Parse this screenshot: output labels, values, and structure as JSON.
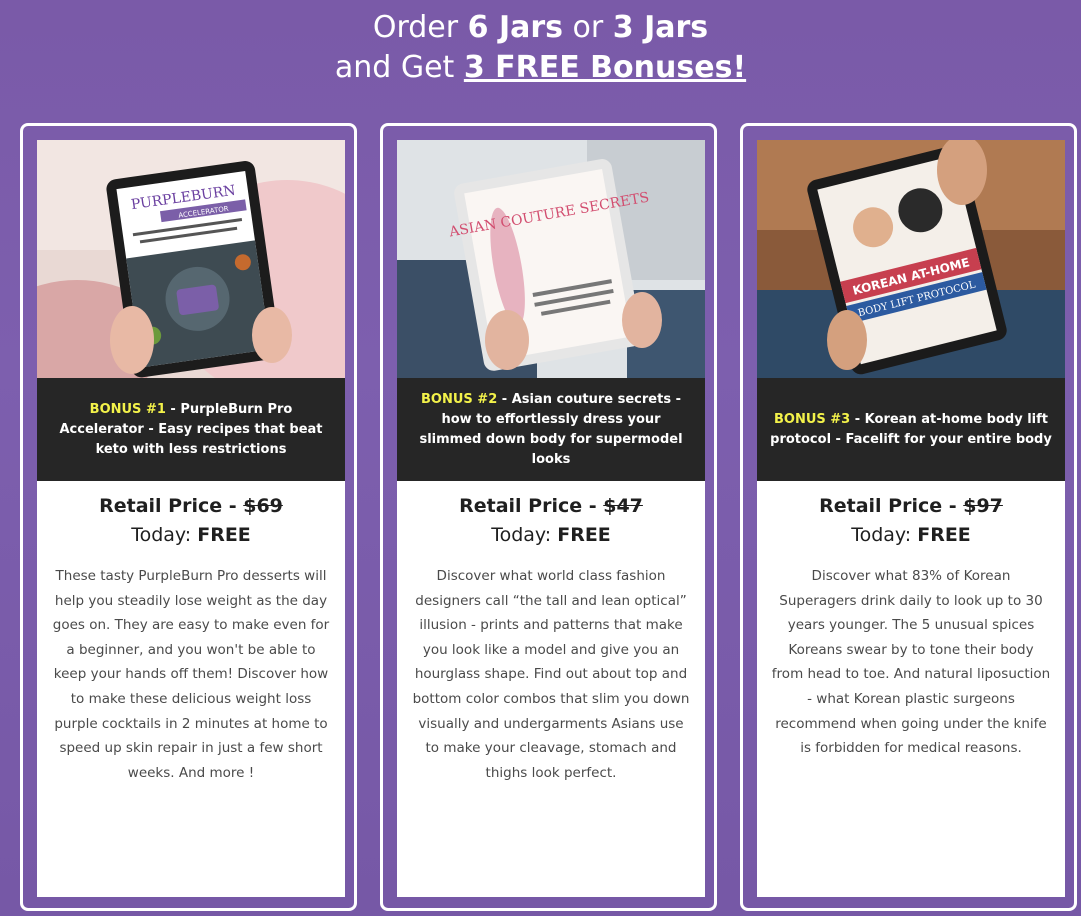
{
  "headline": {
    "line1_pre": "Order ",
    "line1_bold1": "6 Jars",
    "line1_mid": " or ",
    "line1_bold2": "3 Jars",
    "line2_pre": "and Get ",
    "line2_link": "3 FREE Bonuses!"
  },
  "bonuses": [
    {
      "image_label": "PURPLEBURN",
      "image_sub": "ACCELERATOR",
      "image_caption": "EASY RECIPES THAT BEAT KETO WITH LESS RESTRICTIONS",
      "tag": "BONUS #1",
      "text": " - PurpleBurn Pro Accelerator - Easy recipes that beat keto with less restrictions",
      "price_label": "Retail Price - ",
      "price": "$69",
      "today_label": "Today: ",
      "today_value": "FREE",
      "description": "These tasty PurpleBurn Pro desserts will help you steadily lose weight as the day goes on. They are easy to make even for a beginner, and you won't be able to keep your hands off them! Discover how to make these delicious weight loss purple cocktails in 2 minutes at home to speed up skin repair in just a few short weeks. And more !"
    },
    {
      "image_label": "ASIAN COUTURE SECRETS",
      "image_caption": "HOW TO EFFORTLESSLY DRESS YOUR SLIMMED DOWN BODY FOR SUPERMODEL LOOKS",
      "tag": "BONUS #2",
      "text": " - Asian couture secrets - how to effortlessly dress your slimmed down body for supermodel looks",
      "price_label": "Retail Price - ",
      "price": "$47",
      "today_label": "Today: ",
      "today_value": "FREE",
      "description": "Discover what world class fashion designers call “the tall and lean optical” illusion - prints and patterns that make you look like a model and give you an hourglass shape. Find out about top and bottom color combos that slim you down visually and undergarments Asians use to make your cleavage, stomach and thighs look perfect."
    },
    {
      "image_label": "KOREAN AT-HOME",
      "image_sub": "BODY LIFT PROTOCOL",
      "image_caption": "FACELIFT FOR YOUR ENTIRE BODY",
      "tag": "BONUS #3",
      "text": " - Korean at-home body lift protocol - Facelift for your entire body",
      "price_label": "Retail Price - ",
      "price": "$97",
      "today_label": "Today: ",
      "today_value": "FREE",
      "description": "Discover what 83% of Korean Superagers drink daily to look up to 30 years younger. The 5 unusual spices Koreans swear by to tone their body from head to toe. And natural liposuction - what Korean plastic surgeons recommend when going under the knife is forbidden for medical reasons."
    }
  ],
  "colors": {
    "background": "#7a5aa8",
    "bonus_bar": "#262626",
    "bonus_tag": "#f3f24a",
    "card": "#ffffff"
  }
}
